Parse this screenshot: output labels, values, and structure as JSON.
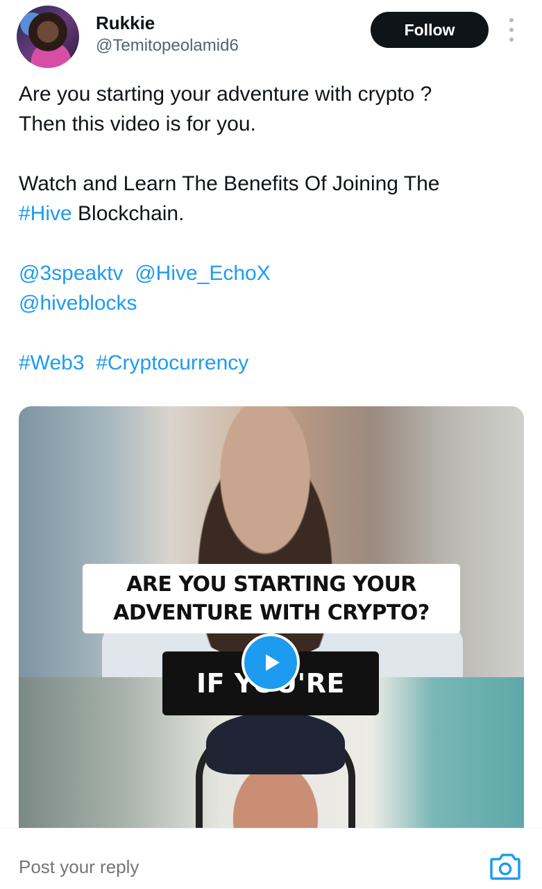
{
  "author": {
    "name": "Rukkie",
    "handle": "@Temitopeolamid6"
  },
  "actions": {
    "follow_label": "Follow",
    "more_icon": "more-vertical-icon"
  },
  "tweet": {
    "line1": "Are you starting your adventure with crypto ?",
    "line2": "Then this video is for you.",
    "line3": "Watch and Learn The Benefits Of Joining The",
    "hashtag_hive": "#Hive",
    "line4_rest": " Blockchain.",
    "mention_3speak": "@3speaktv",
    "mention_echox": "@Hive_EchoX",
    "mention_hiveblocks": "@hiveblocks",
    "hashtag_web3": "#Web3",
    "hashtag_crypto": "#Cryptocurrency"
  },
  "video": {
    "caption_line1": "ARE YOU STARTING YOUR",
    "caption_line2": "ADVENTURE WITH CRYPTO?",
    "subtitle": "IF YOU'RE",
    "play_icon": "play-icon"
  },
  "reply": {
    "placeholder": "Post your reply",
    "camera_icon": "camera-icon"
  },
  "colors": {
    "link": "#1d9bf0",
    "follow_bg": "#0f1419",
    "muted": "#536471"
  }
}
